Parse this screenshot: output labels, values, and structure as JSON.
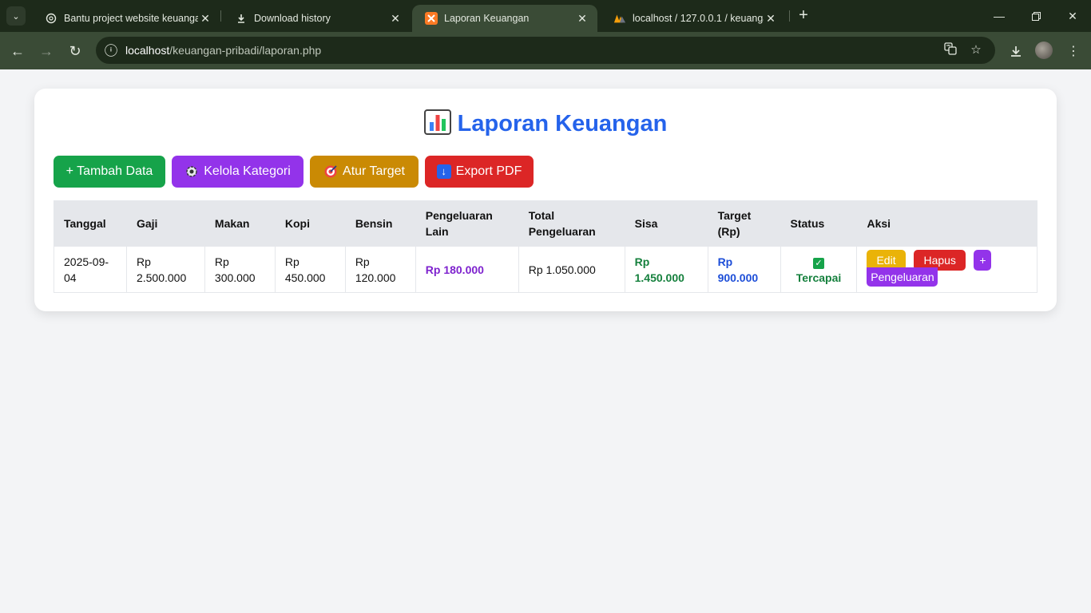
{
  "browser": {
    "tabs": [
      {
        "title": "Bantu project website keuangan",
        "icon": "openai-icon"
      },
      {
        "title": "Download history",
        "icon": "download-icon"
      },
      {
        "title": "Laporan Keuangan",
        "icon": "xampp-icon",
        "active": true
      },
      {
        "title": "localhost / 127.0.0.1 / keuangan",
        "icon": "phpmyadmin-icon"
      }
    ],
    "url_host": "localhost",
    "url_path": "/keuangan-pribadi/laporan.php"
  },
  "page": {
    "title": "Laporan Keuangan",
    "buttons": {
      "tambah": "+ Tambah Data",
      "kategori": "Kelola Kategori",
      "target": "Atur Target",
      "export": "Export PDF"
    },
    "colors": {
      "title": "#2563eb",
      "tambah": "#16a34a",
      "kategori": "#9333ea",
      "target": "#ca8a04",
      "export": "#dc2626"
    }
  },
  "table": {
    "headers": {
      "tanggal": "Tanggal",
      "gaji": "Gaji",
      "makan": "Makan",
      "kopi": "Kopi",
      "bensin": "Bensin",
      "lain": "Pengeluaran Lain",
      "total": "Total Pengeluaran",
      "sisa": "Sisa",
      "target": "Target (Rp)",
      "status": "Status",
      "aksi": "Aksi"
    },
    "rows": [
      {
        "tanggal": "2025-09-04",
        "gaji": "Rp 2.500.000",
        "makan": "Rp 300.000",
        "kopi": "Rp 450.000",
        "bensin": "Rp 120.000",
        "lain": "Rp 180.000",
        "total": "Rp 1.050.000",
        "sisa": "Rp 1.450.000",
        "target": "Rp 900.000",
        "status": "Tercapai",
        "edit": "Edit",
        "hapus": "Hapus",
        "tambah_plus": "+",
        "tambah_label": "Pengeluaran"
      }
    ]
  }
}
